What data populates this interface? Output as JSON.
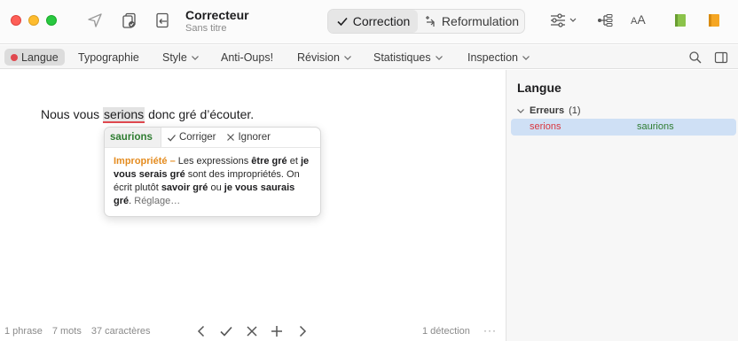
{
  "titlebar": {
    "title": "Correcteur",
    "subtitle": "Sans titre",
    "mode_correction": "Correction",
    "mode_reformulation": "Reformulation",
    "font_size_label_big": "A",
    "font_size_label_small": "A",
    "book_colors": [
      "#8bc34a",
      "#f5a623"
    ]
  },
  "tabs": {
    "items": [
      {
        "label": "Langue",
        "dropdown": false,
        "active": true
      },
      {
        "label": "Typographie",
        "dropdown": false
      },
      {
        "label": "Style",
        "dropdown": true
      },
      {
        "label": "Anti-Oups!",
        "dropdown": false
      },
      {
        "label": "Révision",
        "dropdown": true
      },
      {
        "label": "Statistiques",
        "dropdown": true
      },
      {
        "label": "Inspection",
        "dropdown": true
      }
    ]
  },
  "editor": {
    "before": "Nous vous ",
    "error_word": "serions",
    "after": " donc gré d’écouter."
  },
  "popover": {
    "suggestion": "saurions",
    "correct_label": "Corriger",
    "ignore_label": "Ignorer",
    "kind": "Impropriété –",
    "t1": " Les expressions ",
    "b1": "être gré",
    "t2": " et ",
    "b2": "je vous serais gré",
    "t3": " sont des impropriétés. On écrit plutôt ",
    "b3": "savoir gré",
    "t4": " ou ",
    "b4": "je vous saurais gré",
    "t5": ". ",
    "more": "Réglage…"
  },
  "status": {
    "phrases": "1 phrase",
    "words": "7 mots",
    "chars": "37 caractères",
    "detections": "1 détection",
    "more": "···"
  },
  "panel": {
    "title": "Langue",
    "group_label": "Erreurs",
    "group_count": "(1)",
    "error_word": "serions",
    "suggestion": "saurions"
  },
  "colors": {
    "error": "#d9363e",
    "suggestion": "#2f7d32",
    "kind": "#e48c20",
    "selection": "#cfe0f5"
  }
}
